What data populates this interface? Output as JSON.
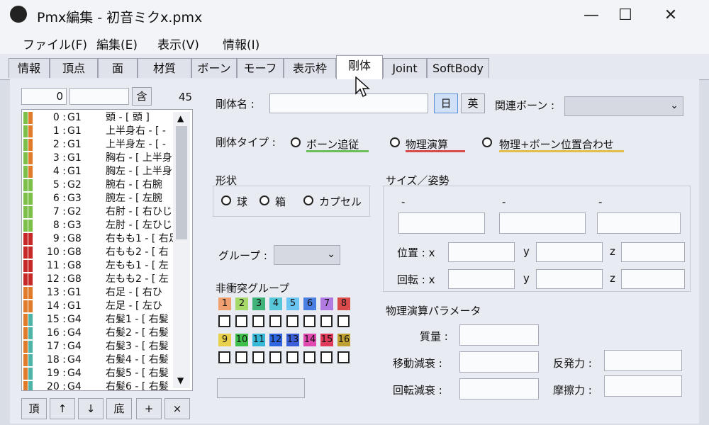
{
  "window": {
    "title": "Pmx編集 - 初音ミクx.pmx",
    "min": "—",
    "max": "☐",
    "close": "✕"
  },
  "menu": [
    "ファイル(F)",
    "編集(E)",
    "表示(V)",
    "情報(I)"
  ],
  "tabs": [
    "情報",
    "頂点",
    "面",
    "材質",
    "ボーン",
    "モーフ",
    "表示枠",
    "剛体",
    "Joint",
    "SoftBody"
  ],
  "active_tab": "剛体",
  "left": {
    "index_value": "0",
    "contain_label": "含",
    "count": "45",
    "rows": [
      {
        "num": "0",
        "grp": "G1",
        "name": "頭 - [ 頭 ]",
        "c1": "#7cc04a",
        "c2": "#e07b2b"
      },
      {
        "num": "1",
        "grp": "G1",
        "name": "上半身右 - [ -",
        "c1": "#7cc04a",
        "c2": "#e07b2b"
      },
      {
        "num": "2",
        "grp": "G1",
        "name": "上半身左 - [ -",
        "c1": "#7cc04a",
        "c2": "#e07b2b"
      },
      {
        "num": "3",
        "grp": "G1",
        "name": "胸右 - [ 上半身",
        "c1": "#7cc04a",
        "c2": "#e07b2b"
      },
      {
        "num": "4",
        "grp": "G1",
        "name": "胸左 - [ 上半身",
        "c1": "#7cc04a",
        "c2": "#e07b2b"
      },
      {
        "num": "5",
        "grp": "G2",
        "name": "腕右 - [ 右腕",
        "c1": "#7cc04a",
        "c2": "#7cc04a"
      },
      {
        "num": "6",
        "grp": "G3",
        "name": "腕左 - [ 左腕",
        "c1": "#7cc04a",
        "c2": "#7cc04a"
      },
      {
        "num": "7",
        "grp": "G2",
        "name": "右肘 - [ 右ひじ",
        "c1": "#7cc04a",
        "c2": "#7cc04a"
      },
      {
        "num": "8",
        "grp": "G3",
        "name": "左肘 - [ 左ひじ",
        "c1": "#7cc04a",
        "c2": "#7cc04a"
      },
      {
        "num": "9",
        "grp": "G8",
        "name": "右もも1 - [ 右足",
        "c1": "#c62828",
        "c2": "#c62828"
      },
      {
        "num": "10",
        "grp": "G8",
        "name": "右もも2 - [ 右",
        "c1": "#c62828",
        "c2": "#c62828"
      },
      {
        "num": "11",
        "grp": "G8",
        "name": "左もも1 - [ 左",
        "c1": "#c62828",
        "c2": "#c62828"
      },
      {
        "num": "12",
        "grp": "G8",
        "name": "左もも2 - [ 左",
        "c1": "#c62828",
        "c2": "#c62828"
      },
      {
        "num": "13",
        "grp": "G1",
        "name": "右足 - [ 右ひ",
        "c1": "#e07b2b",
        "c2": "#e07b2b"
      },
      {
        "num": "14",
        "grp": "G1",
        "name": "左足 - [ 左ひ",
        "c1": "#e07b2b",
        "c2": "#e07b2b"
      },
      {
        "num": "15",
        "grp": "G4",
        "name": "右髪1 - [ 右髪",
        "c1": "#e07b2b",
        "c2": "#4fb3a8"
      },
      {
        "num": "16",
        "grp": "G4",
        "name": "右髪2 - [ 右髪",
        "c1": "#e07b2b",
        "c2": "#4fb3a8"
      },
      {
        "num": "17",
        "grp": "G4",
        "name": "右髪3 - [ 右髪",
        "c1": "#e07b2b",
        "c2": "#4fb3a8"
      },
      {
        "num": "18",
        "grp": "G4",
        "name": "右髪4 - [ 右髪",
        "c1": "#e07b2b",
        "c2": "#4fb3a8"
      },
      {
        "num": "19",
        "grp": "G4",
        "name": "右髪5 - [ 右髪",
        "c1": "#e07b2b",
        "c2": "#4fb3a8"
      },
      {
        "num": "20",
        "grp": "G4",
        "name": "右髪6 - [ 右髪",
        "c1": "#e07b2b",
        "c2": "#4fb3a8"
      }
    ],
    "buttons": [
      "頂",
      "↑",
      "↓",
      "底",
      "+",
      "×"
    ]
  },
  "form": {
    "name_label": "剛体名 :",
    "jp_btn": "日",
    "en_btn": "英",
    "bone_label": "関連ボーン :",
    "type_label": "剛体タイプ :",
    "type_options": [
      {
        "label": "ボーン追従",
        "color": "#6bbf59"
      },
      {
        "label": "物理演算",
        "color": "#d94a4a"
      },
      {
        "label": "物理+ボーン位置合わせ",
        "color": "#e0c04a"
      }
    ],
    "shape_label": "形状",
    "shape_options": [
      "球",
      "箱",
      "カプセル"
    ],
    "group_label": "グループ :",
    "noncollide_label": "非衝突グループ",
    "groups_top": [
      {
        "n": "1",
        "c": "#f0a070"
      },
      {
        "n": "2",
        "c": "#a6d86a"
      },
      {
        "n": "3",
        "c": "#3fb37a"
      },
      {
        "n": "4",
        "c": "#57c6d6"
      },
      {
        "n": "5",
        "c": "#6ac6f0"
      },
      {
        "n": "6",
        "c": "#4a7ee0"
      },
      {
        "n": "7",
        "c": "#b07ae0"
      },
      {
        "n": "8",
        "c": "#d94a4a"
      }
    ],
    "groups_bottom": [
      {
        "n": "9",
        "c": "#e8d04a"
      },
      {
        "n": "10",
        "c": "#3fc04a"
      },
      {
        "n": "11",
        "c": "#37b8d6"
      },
      {
        "n": "12",
        "c": "#2f66e0"
      },
      {
        "n": "13",
        "c": "#3a5fd9"
      },
      {
        "n": "14",
        "c": "#e04ab0"
      },
      {
        "n": "15",
        "c": "#e03a5a"
      },
      {
        "n": "16",
        "c": "#c0a030"
      }
    ],
    "size_label": "サイズ／姿勢",
    "size_dash": [
      "-",
      "-",
      "-"
    ],
    "pos_label": "位置 : x",
    "rot_label": "回転 : x",
    "y_label": "y",
    "z_label": "z",
    "physics_label": "物理演算パラメータ",
    "mass_label": "質量 :",
    "move_damp_label": "移動減衰 :",
    "rot_damp_label": "回転減衰 :",
    "restitution_label": "反発力 :",
    "friction_label": "摩擦力 :"
  }
}
